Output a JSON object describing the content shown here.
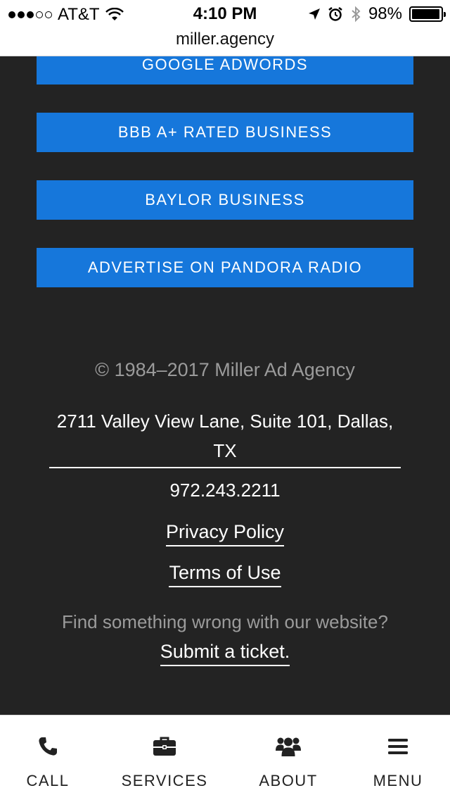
{
  "status_bar": {
    "carrier": "AT&T",
    "time": "4:10 PM",
    "battery": "98%",
    "battery_level": 0.98
  },
  "browser": {
    "url": "miller.agency"
  },
  "buttons": [
    {
      "label": "GOOGLE ADWORDS"
    },
    {
      "label": "BBB A+ RATED BUSINESS"
    },
    {
      "label": "BAYLOR BUSINESS"
    },
    {
      "label": "ADVERTISE ON PANDORA RADIO"
    }
  ],
  "footer": {
    "copyright": "© 1984–2017 Miller Ad Agency",
    "address": "2711 Valley View Lane, Suite 101, Dallas, TX",
    "phone": "972.243.2211",
    "privacy": "Privacy Policy",
    "terms": "Terms of Use",
    "report_question": "Find something wrong with our website?",
    "report_link": "Submit a ticket."
  },
  "nav": [
    {
      "label": "CALL",
      "icon": "phone-icon"
    },
    {
      "label": "SERVICES",
      "icon": "briefcase-icon"
    },
    {
      "label": "ABOUT",
      "icon": "users-icon"
    },
    {
      "label": "MENU",
      "icon": "hamburger-menu-icon"
    }
  ]
}
